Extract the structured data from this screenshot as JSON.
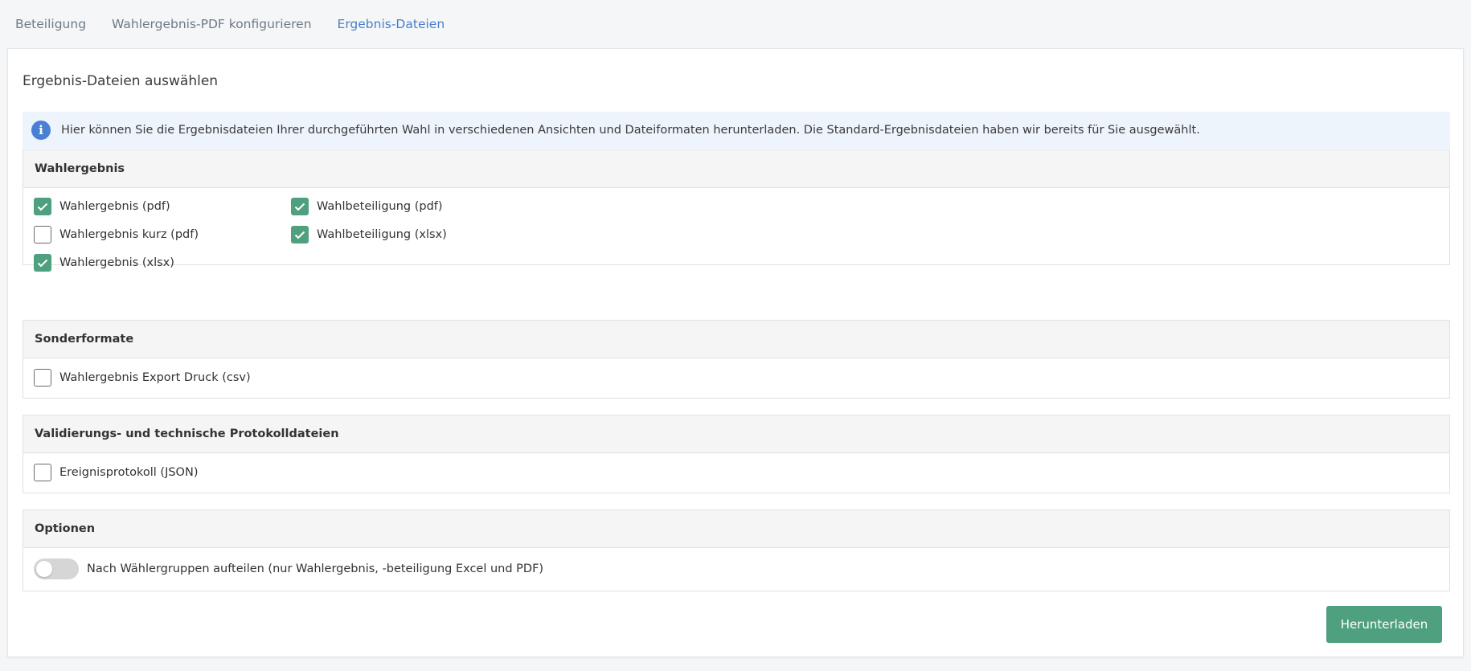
{
  "tabs": [
    {
      "label": "Beteiligung",
      "active": false
    },
    {
      "label": "Wahlergebnis-PDF konfigurieren",
      "active": false
    },
    {
      "label": "Ergebnis-Dateien",
      "active": true
    }
  ],
  "title": "Ergebnis-Dateien auswählen",
  "info": {
    "icon": "info-icon",
    "text": "Hier können Sie die Ergebnisdateien Ihrer durchgeführten Wahl in verschiedenen Ansichten und Dateiformaten herunterladen. Die Standard-Ergebnisdateien haben wir bereits für Sie ausgewählt."
  },
  "sections": {
    "wahlergebnis": {
      "title": "Wahlergebnis",
      "items": [
        {
          "label": "Wahlergebnis (pdf)",
          "checked": true
        },
        {
          "label": "Wahlergebnis kurz (pdf)",
          "checked": false
        },
        {
          "label": "Wahlergebnis (xlsx)",
          "checked": true
        },
        {
          "label": "Wahlbeteiligung (pdf)",
          "checked": true
        },
        {
          "label": "Wahlbeteiligung (xlsx)",
          "checked": true
        }
      ]
    },
    "sonderformate": {
      "title": "Sonderformate",
      "items": [
        {
          "label": "Wahlergebnis Export Druck (csv)",
          "checked": false
        }
      ]
    },
    "validierung": {
      "title": "Validierungs- und technische Protokolldateien",
      "items": [
        {
          "label": "Ereignisprotokoll (JSON)",
          "checked": false
        }
      ]
    },
    "optionen": {
      "title": "Optionen",
      "toggle_label": "Nach Wählergruppen aufteilen (nur Wahlergebnis, -beteiligung Excel und PDF)",
      "toggle_on": false
    }
  },
  "download_label": "Herunterladen",
  "colors": {
    "accent_green": "#4fa07f",
    "tab_active": "#4a7fc9",
    "info_bg": "#edf4fc",
    "info_icon": "#4a7fd6"
  }
}
